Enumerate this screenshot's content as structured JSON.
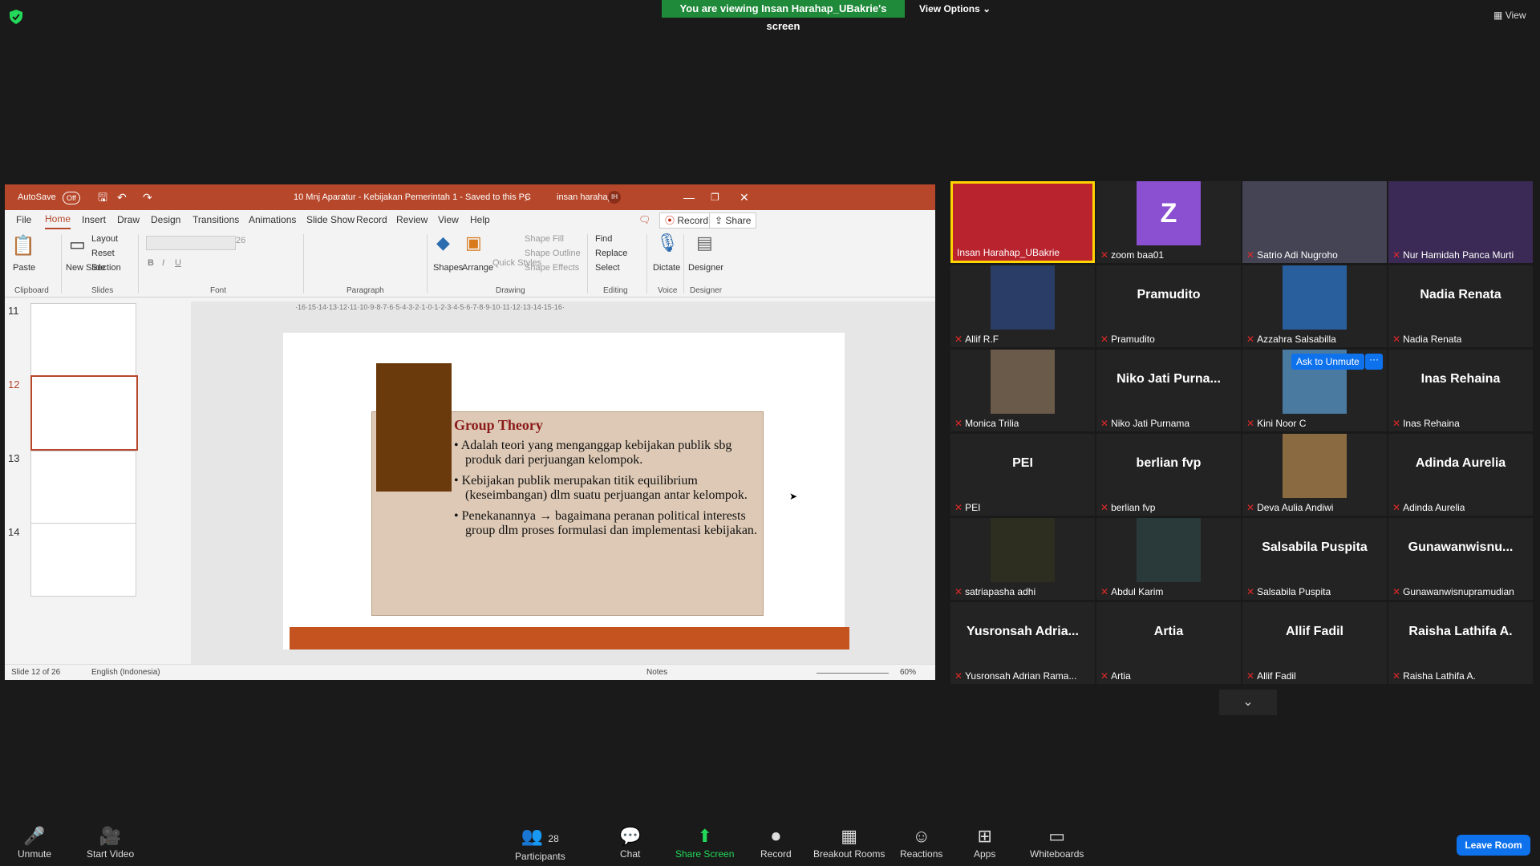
{
  "top": {
    "banner": "You are viewing Insan Harahap_UBakrie's screen",
    "view_options": "View Options",
    "view": "View"
  },
  "ppt": {
    "autosave": "AutoSave",
    "autosave_state": "Off",
    "doc_title": "10  Mnj Aparatur - Kebijakan Pemerintah 1 - Saved to this PC",
    "user": "insan harahap",
    "user_initials": "IH",
    "menu": [
      "File",
      "Home",
      "Insert",
      "Draw",
      "Design",
      "Transitions",
      "Animations",
      "Slide Show",
      "Record",
      "Review",
      "View",
      "Help"
    ],
    "record_btn": "Record",
    "share_btn": "Share",
    "ribbon": {
      "paste": "Paste",
      "new_slide": "New Slide",
      "layout": "Layout",
      "reset": "Reset",
      "section": "Section",
      "font_size": "26",
      "shapes": "Shapes",
      "arrange": "Arrange",
      "quick_styles": "Quick Styles",
      "shape_fill": "Shape Fill",
      "shape_outline": "Shape Outline",
      "shape_effects": "Shape Effects",
      "find": "Find",
      "replace": "Replace",
      "select": "Select",
      "dictate": "Dictate",
      "designer": "Designer",
      "groups": [
        "Clipboard",
        "Slides",
        "Font",
        "Paragraph",
        "Drawing",
        "Editing",
        "Voice",
        "Designer"
      ]
    },
    "thumbs": [
      {
        "num": "11"
      },
      {
        "num": "12"
      },
      {
        "num": "13"
      },
      {
        "num": "14"
      }
    ],
    "ruler": "·16·15·14·13·12·11·10·9·8·7·6·5·4·3·2·1·0·1·2·3·4·5·6·7·8·9·10·11·12·13·14·15·16·",
    "slide": {
      "title": "Group Theory",
      "b1": "Adalah teori yang menganggap kebijakan publik sbg produk dari perjuangan kelompok.",
      "b2": "Kebijakan publik merupakan titik equilibrium (keseimbangan) dlm suatu perjuangan antar kelompok.",
      "b3": "Penekanannya → bagaimana peranan political interests group dlm proses formulasi dan implementasi kebijakan."
    },
    "status": {
      "slide_of": "Slide 12 of 26",
      "language": "English (Indonesia)",
      "notes": "Notes",
      "zoom": "60%"
    }
  },
  "gallery": [
    {
      "label": "Insan Harahap_UBakrie",
      "big": "",
      "muted": false,
      "active": true
    },
    {
      "label": "zoom baa01",
      "big": "Z",
      "muted": true
    },
    {
      "label": "Satrio Adi Nugroho",
      "big": "",
      "muted": true
    },
    {
      "label": "Nur Hamidah Panca Murti",
      "big": "",
      "muted": true
    },
    {
      "label": "Allif R.F",
      "big": "",
      "muted": true
    },
    {
      "label": "Pramudito",
      "big": "Pramudito",
      "muted": true
    },
    {
      "label": "Azzahra Salsabilla",
      "big": "",
      "muted": true
    },
    {
      "label": "Nadia Renata",
      "big": "Nadia Renata",
      "muted": true
    },
    {
      "label": "Monica Trilia",
      "big": "",
      "muted": true
    },
    {
      "label": "Niko Jati Purnama",
      "big": "Niko  Jati  Purna...",
      "muted": true
    },
    {
      "label": "Kini Noor C",
      "big": "",
      "muted": true
    },
    {
      "label": "Inas Rehaina",
      "big": "Inas Rehaina",
      "muted": true
    },
    {
      "label": "PEI",
      "big": "PEI",
      "muted": true
    },
    {
      "label": "berlian fvp",
      "big": "berlian fvp",
      "muted": true
    },
    {
      "label": "Deva Aulia Andiwi",
      "big": "",
      "muted": true
    },
    {
      "label": "Adinda Aurelia",
      "big": "Adinda Aurelia",
      "muted": true
    },
    {
      "label": "satriapasha adhi",
      "big": "",
      "muted": true
    },
    {
      "label": "Abdul Karim",
      "big": "",
      "muted": true
    },
    {
      "label": "Salsabila Puspita",
      "big": "Salsabila Puspita",
      "muted": true
    },
    {
      "label": "Gunawanwisnupramudian",
      "big": "Gunawanwisnu...",
      "muted": true
    },
    {
      "label": "Yusronsah Adrian Rama...",
      "big": "Yusronsah  Adria...",
      "muted": true
    },
    {
      "label": "Artia",
      "big": "Artia",
      "muted": true
    },
    {
      "label": "Allif Fadil",
      "big": "Allif Fadil",
      "muted": true
    },
    {
      "label": "Raisha Lathifa A.",
      "big": "Raisha Lathifa A.",
      "muted": true
    }
  ],
  "ask_unmute": "Ask to Unmute",
  "ask_unmute_more": "···",
  "toolbar": {
    "unmute": "Unmute",
    "start_video": "Start Video",
    "participants": "Participants",
    "participants_count": "28",
    "chat": "Chat",
    "share_screen": "Share Screen",
    "record": "Record",
    "breakout": "Breakout Rooms",
    "reactions": "Reactions",
    "apps": "Apps",
    "whiteboards": "Whiteboards",
    "leave": "Leave Room"
  }
}
